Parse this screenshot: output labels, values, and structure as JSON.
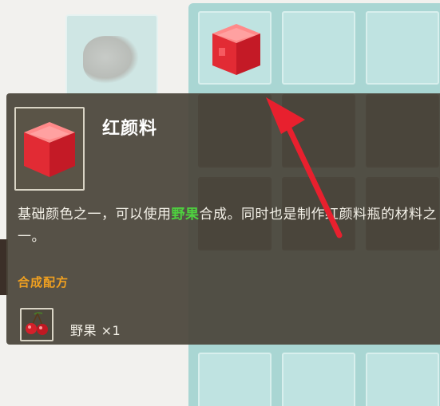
{
  "item": {
    "name": "红颜料",
    "description_parts": [
      {
        "text": "基础颜色之一，可以使用",
        "highlight": false
      },
      {
        "text": "野果",
        "highlight": true
      },
      {
        "text": "合成。同时也是制作红颜料瓶的材料之一。",
        "highlight": false
      }
    ],
    "icon": "red-pigment-cube-icon"
  },
  "recipe": {
    "header": "合成配方",
    "ingredients": [
      {
        "name": "野果",
        "quantity": "×1",
        "icon": "wild-berry-icon"
      }
    ]
  },
  "colors": {
    "highlight": "#4ed23f",
    "recipe_header": "#f0a020",
    "tooltip_bg": "#4a453a",
    "arrow": "#e8202e"
  }
}
